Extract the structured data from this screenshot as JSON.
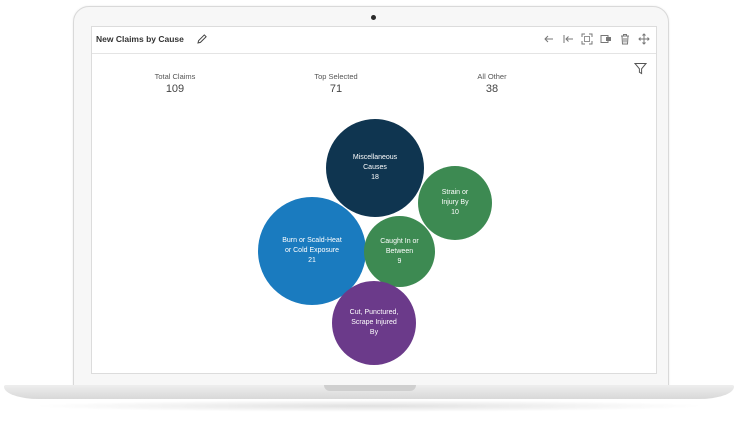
{
  "panel": {
    "title": "New Claims by Cause"
  },
  "toolbar": {
    "icons": [
      "arrow-left-icon",
      "collapse-left-icon",
      "expand-icon",
      "export-icon",
      "trash-icon",
      "move-icon"
    ]
  },
  "kpis": [
    {
      "label": "Total Claims",
      "value": "109"
    },
    {
      "label": "Top Selected",
      "value": "71"
    },
    {
      "label": "All Other",
      "value": "38"
    }
  ],
  "colors": {
    "navy": "#0f3550",
    "green": "#3d8a52",
    "blue": "#1a7bbf",
    "purple": "#6b3a8a"
  },
  "chart_data": {
    "type": "bubble",
    "title": "",
    "series": [
      {
        "label": "Miscellaneous Causes",
        "label_lines": [
          "Miscellaneous",
          "Causes"
        ],
        "value": 18,
        "value_text": "18",
        "color": "#0f3550"
      },
      {
        "label": "Strain or Injury By",
        "label_lines": [
          "Strain or",
          "Injury By"
        ],
        "value": 10,
        "value_text": "10",
        "color": "#3d8a52"
      },
      {
        "label": "Burn or Scald-Heat or Cold Exposure",
        "label_lines": [
          "Burn or Scald-Heat",
          "or Cold Exposure"
        ],
        "value": 21,
        "value_text": "21",
        "color": "#1a7bbf"
      },
      {
        "label": "Caught In or Between",
        "label_lines": [
          "Caught In or",
          "Between"
        ],
        "value": 9,
        "value_text": "9",
        "color": "#3d8a52"
      },
      {
        "label": "Cut, Punctured, Scrape Injured By",
        "label_lines": [
          "Cut, Punctured,",
          "Scrape Injured",
          "By"
        ],
        "value": null,
        "value_text": "",
        "color": "#6b3a8a"
      }
    ]
  }
}
